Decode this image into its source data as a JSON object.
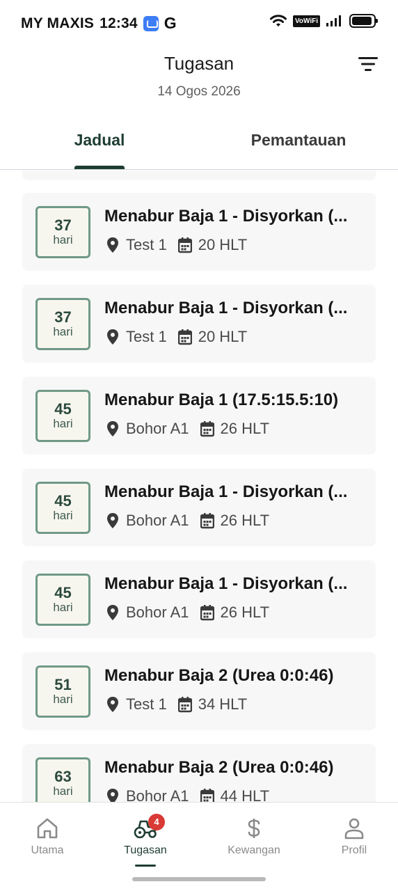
{
  "status_bar": {
    "carrier": "MY MAXIS",
    "time": "12:34",
    "vowifi": "VoWiFi"
  },
  "header": {
    "title": "Tugasan",
    "date": "14 Ogos 2026"
  },
  "tabs": [
    {
      "label": "Jadual",
      "active": true
    },
    {
      "label": "Pemantauan",
      "active": false
    }
  ],
  "tasks": [
    {
      "days": "37",
      "unit": "hari",
      "title": "Menabur Baja 1 - Disyorkan (...",
      "location": "Test 1",
      "hlt": "20 HLT"
    },
    {
      "days": "37",
      "unit": "hari",
      "title": "Menabur Baja 1 - Disyorkan (...",
      "location": "Test 1",
      "hlt": "20 HLT"
    },
    {
      "days": "45",
      "unit": "hari",
      "title": "Menabur Baja 1 (17.5:15.5:10)",
      "location": "Bohor A1",
      "hlt": "26 HLT"
    },
    {
      "days": "45",
      "unit": "hari",
      "title": "Menabur Baja 1 - Disyorkan (...",
      "location": "Bohor A1",
      "hlt": "26 HLT"
    },
    {
      "days": "45",
      "unit": "hari",
      "title": "Menabur Baja 1 - Disyorkan (...",
      "location": "Bohor A1",
      "hlt": "26 HLT"
    },
    {
      "days": "51",
      "unit": "hari",
      "title": "Menabur Baja 2 (Urea 0:0:46)",
      "location": "Test 1",
      "hlt": "34 HLT"
    },
    {
      "days": "63",
      "unit": "hari",
      "title": "Menabur Baja 2 (Urea 0:0:46)",
      "location": "Bohor A1",
      "hlt": "44 HLT"
    }
  ],
  "bottom_nav": {
    "items": [
      {
        "label": "Utama",
        "icon": "home-icon"
      },
      {
        "label": "Tugasan",
        "icon": "tractor-icon",
        "badge": "4",
        "active": true
      },
      {
        "label": "Kewangan",
        "icon": "dollar-icon"
      },
      {
        "label": "Profil",
        "icon": "person-icon"
      }
    ]
  },
  "colors": {
    "accent": "#1e3d32",
    "day_border": "#6f9986",
    "badge": "#d93a35",
    "card_bg": "#f7f7f7"
  }
}
